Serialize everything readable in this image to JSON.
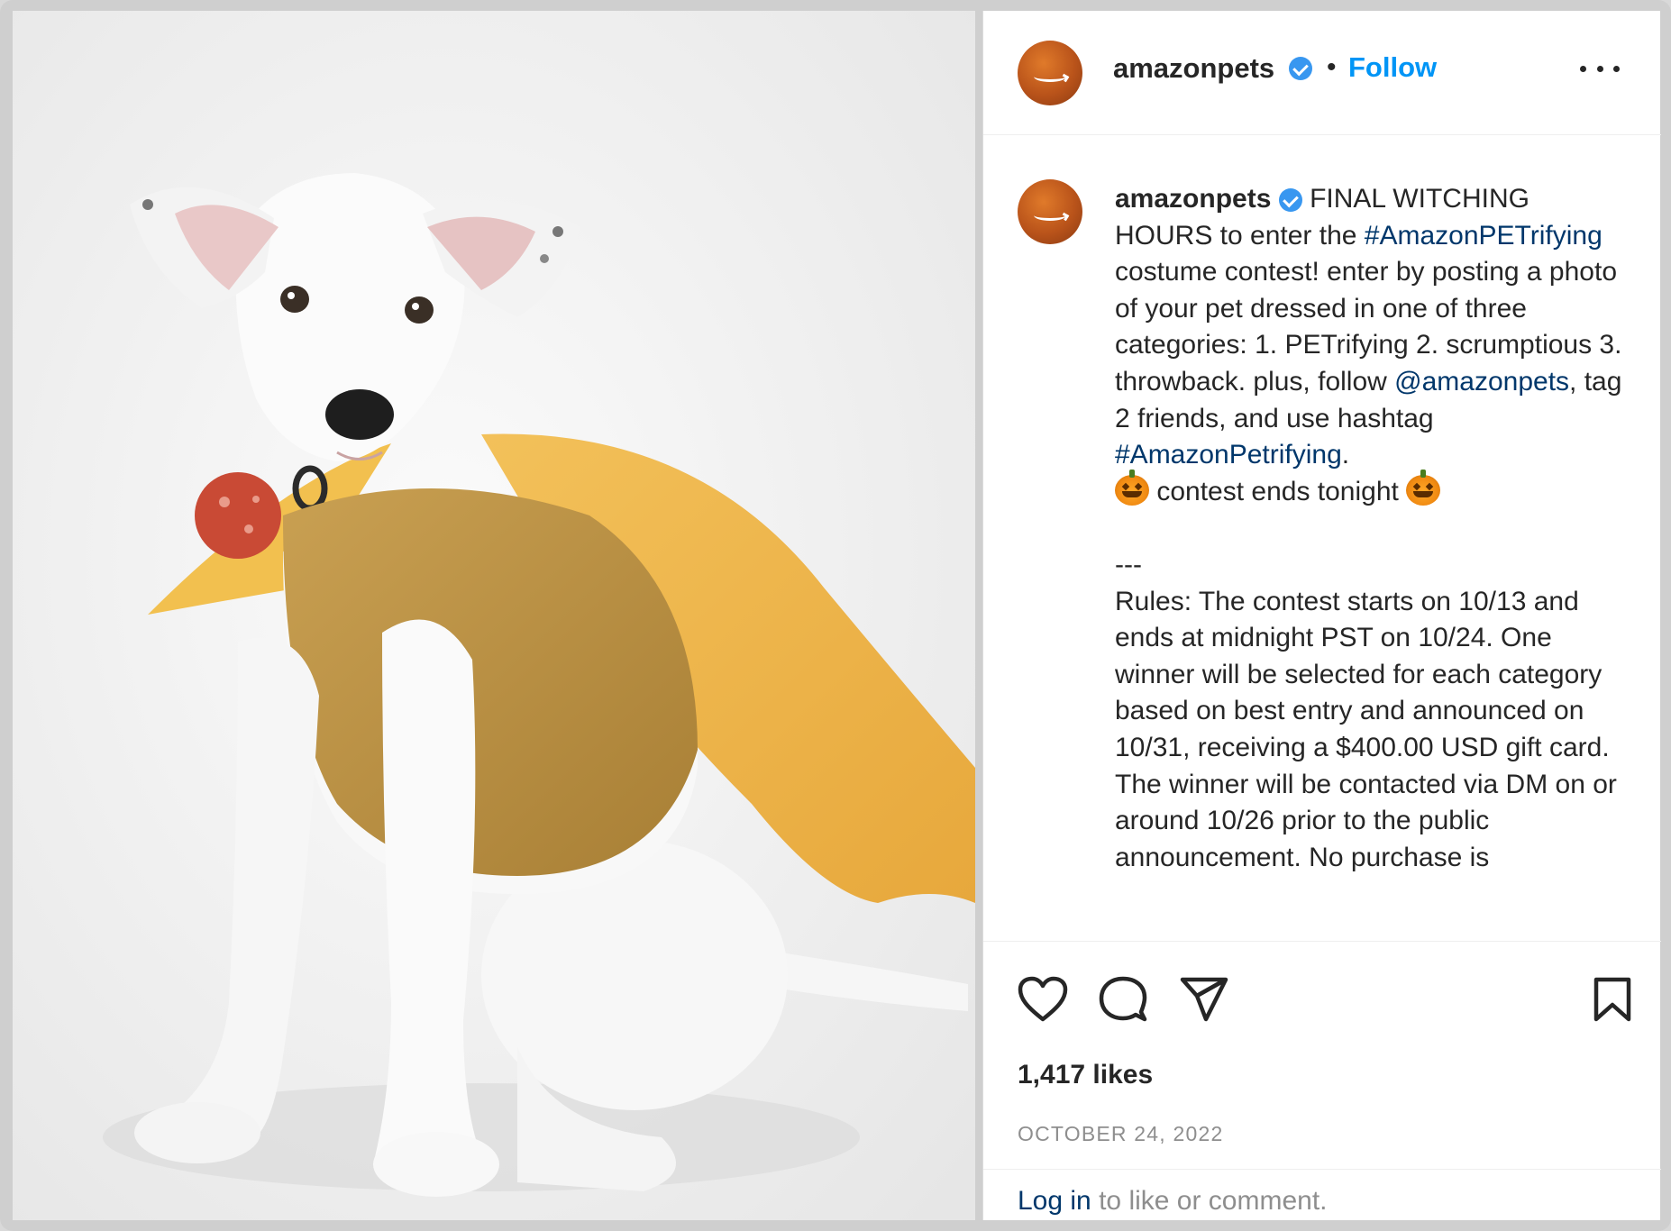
{
  "post": {
    "username": "amazonpets",
    "follow_label": "Follow",
    "dot": "•",
    "caption": {
      "username": "amazonpets",
      "p1": " FINAL WITCHING HOURS to enter the ",
      "tag1": "#AmazonPETrifying",
      "p2": " costume contest! enter by posting a photo of your pet dressed in one of three categories: 1. PETrifying 2. scrumptious 3. throwback. plus, follow ",
      "mention": "@amazonpets",
      "p3": ", tag 2 friends, and use hashtag ",
      "tag2": "#AmazonPetrifying",
      "p4": ".",
      "contest_ends": " contest ends tonight ",
      "separator": "---",
      "rules": "Rules: The contest starts on 10/13 and ends at midnight PST on 10/24. One winner will be selected for each category based on best entry and announced on 10/31, receiving a $400.00 USD gift card. The winner will be contacted via DM on or around 10/26 prior to the public announcement. No purchase is"
    },
    "likes": "1,417 likes",
    "date": "OCTOBER 24, 2022",
    "login_link": "Log in",
    "login_rest": " to like or comment."
  },
  "icons": {
    "like": "heart-icon",
    "comment": "comment-icon",
    "share": "send-icon",
    "save": "bookmark-icon",
    "verified": "verified-badge-icon",
    "more": "more-options-icon"
  },
  "colors": {
    "accent": "#0095f6",
    "link": "#00376b",
    "muted": "#8e8e8e",
    "verified": "#3897f0"
  }
}
